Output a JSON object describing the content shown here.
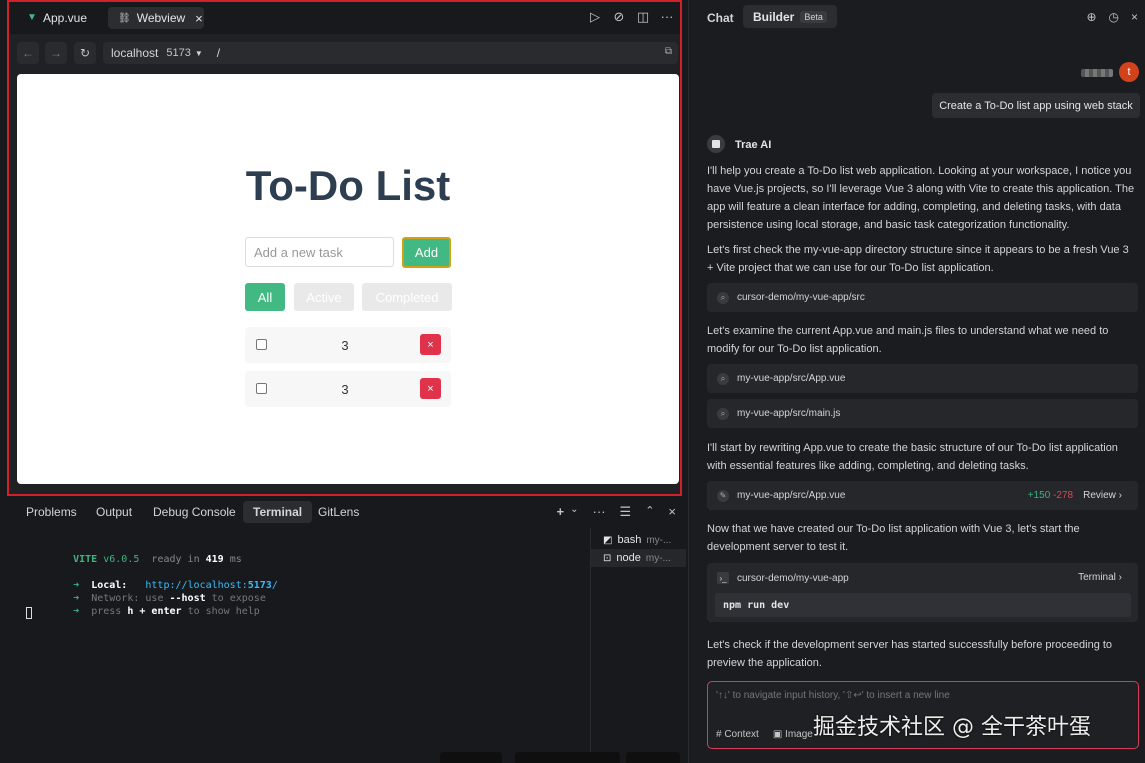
{
  "editor": {
    "tabs": [
      {
        "label": "App.vue"
      },
      {
        "label": "Webview"
      }
    ],
    "close_glyph": "×",
    "toolbar_icons": [
      "play-icon",
      "compass-icon",
      "split-icon",
      "more-icon"
    ]
  },
  "address_bar": {
    "host": "localhost",
    "port": "5173",
    "path": "/"
  },
  "todo_app": {
    "title": "To-Do List",
    "input_placeholder": "Add a new task",
    "add_label": "Add",
    "filters": [
      "All",
      "Active",
      "Completed"
    ],
    "items": [
      {
        "text": "3",
        "delete": "×"
      },
      {
        "text": "3",
        "delete": "×"
      }
    ]
  },
  "panel": {
    "tabs": [
      "Problems",
      "Output",
      "Debug Console",
      "Terminal",
      "GitLens"
    ],
    "active_tab": "Terminal"
  },
  "terminal": {
    "vite": "VITE",
    "version": "v6.0.5",
    "ready_text": "ready in",
    "ready_ms": "419",
    "ms": "ms",
    "arrow": "➜",
    "local_label": "Local:",
    "local_url_prefix": "http://localhost:",
    "local_url_port": "5173",
    "local_url_suffix": "/",
    "network_label": "Network:",
    "network_text_1": "use",
    "network_flag": "--host",
    "network_text_2": "to expose",
    "help_text_1": "press",
    "help_key": "h + enter",
    "help_text_2": "to show help",
    "sessions": [
      {
        "name": "bash",
        "sub": "my-..."
      },
      {
        "name": "node",
        "sub": "my-..."
      }
    ]
  },
  "chat": {
    "tab_chat": "Chat",
    "tab_builder": "Builder",
    "beta": "Beta",
    "avatar_letter": "t",
    "user_message": "Create a To-Do list app using web stack",
    "ai_name": "Trae AI",
    "paragraphs": [
      "I'll help you create a To-Do list web application. Looking at your workspace, I notice you have Vue.js projects, so I'll leverage Vue 3 along with Vite to create this application. The app will feature a clean interface for adding, completing, and deleting tasks, with data persistence using local storage, and basic task categorization functionality.",
      "Let's first check the my-vue-app directory structure since it appears to be a fresh Vue 3 + Vite project that we can use for our To-Do list application.",
      "Let's examine the current App.vue and main.js files to understand what we need to modify for our To-Do list application.",
      "I'll start by rewriting App.vue to create the basic structure of our To-Do list application with essential features like adding, completing, and deleting tasks.",
      "Now that we have created our To-Do list application with Vue 3, let's start the development server to test it.",
      "Let's check if the development server has started successfully before proceeding to preview the application."
    ],
    "tool_cards": [
      {
        "path": "cursor-demo/my-vue-app/src"
      },
      {
        "path": "my-vue-app/src/App.vue"
      },
      {
        "path": "my-vue-app/src/main.js"
      },
      {
        "path": "my-vue-app/src/App.vue",
        "added": "+150",
        "removed": "-278",
        "action": "Review ›"
      }
    ],
    "command_card": {
      "path": "cursor-demo/my-vue-app",
      "label": "Terminal ›",
      "command": "npm run dev"
    },
    "input_placeholder": "'↑↓' to navigate input history, '⇧↩' to insert a new line",
    "context_label": "# Context",
    "image_label": "Image"
  },
  "watermark": "掘金技术社区 @ 全干茶叶蛋"
}
